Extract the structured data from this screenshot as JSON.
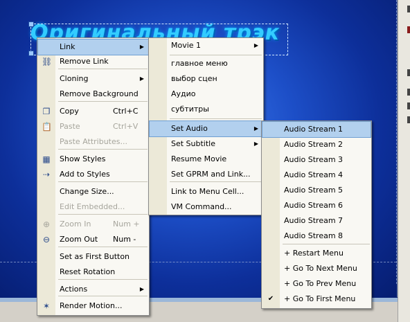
{
  "canvas_title": "Оригинальный трэк",
  "menu_main": {
    "items": [
      {
        "label": "Link",
        "shortcut": "",
        "has_submenu": true,
        "disabled": false,
        "icon": ""
      },
      {
        "label": "Remove Link",
        "shortcut": "",
        "has_submenu": false,
        "disabled": false,
        "icon": "unlink-icon"
      },
      {
        "label": "Cloning",
        "shortcut": "",
        "has_submenu": true,
        "disabled": false,
        "icon": ""
      },
      {
        "label": "Remove Background",
        "shortcut": "",
        "has_submenu": false,
        "disabled": false,
        "icon": ""
      },
      {
        "label": "Copy",
        "shortcut": "Ctrl+C",
        "has_submenu": false,
        "disabled": false,
        "icon": "copy-icon"
      },
      {
        "label": "Paste",
        "shortcut": "Ctrl+V",
        "has_submenu": false,
        "disabled": true,
        "icon": "paste-icon"
      },
      {
        "label": "Paste Attributes...",
        "shortcut": "",
        "has_submenu": false,
        "disabled": true,
        "icon": ""
      },
      {
        "label": "Show Styles",
        "shortcut": "",
        "has_submenu": false,
        "disabled": false,
        "icon": "styles-icon"
      },
      {
        "label": "Add to Styles",
        "shortcut": "",
        "has_submenu": false,
        "disabled": false,
        "icon": "add-styles-icon"
      },
      {
        "label": "Change Size...",
        "shortcut": "",
        "has_submenu": false,
        "disabled": false,
        "icon": ""
      },
      {
        "label": "Edit Embedded...",
        "shortcut": "",
        "has_submenu": false,
        "disabled": true,
        "icon": ""
      },
      {
        "label": "Zoom In",
        "shortcut": "Num +",
        "has_submenu": false,
        "disabled": true,
        "icon": "zoom-in-icon"
      },
      {
        "label": "Zoom Out",
        "shortcut": "Num -",
        "has_submenu": false,
        "disabled": false,
        "icon": "zoom-out-icon"
      },
      {
        "label": "Set as First Button",
        "shortcut": "",
        "has_submenu": false,
        "disabled": false,
        "icon": ""
      },
      {
        "label": "Reset Rotation",
        "shortcut": "",
        "has_submenu": false,
        "disabled": false,
        "icon": ""
      },
      {
        "label": "Actions",
        "shortcut": "",
        "has_submenu": true,
        "disabled": false,
        "icon": ""
      },
      {
        "label": "Render Motion...",
        "shortcut": "",
        "has_submenu": false,
        "disabled": false,
        "icon": "render-motion-icon"
      }
    ]
  },
  "menu_link": {
    "items": [
      {
        "label": "Movie 1",
        "has_submenu": true
      },
      {
        "label": "главное меню",
        "has_submenu": false
      },
      {
        "label": "выбор сцен",
        "has_submenu": false
      },
      {
        "label": "Аудио",
        "has_submenu": false
      },
      {
        "label": "субтитры",
        "has_submenu": false
      },
      {
        "label": "Set Audio",
        "has_submenu": true
      },
      {
        "label": "Set Subtitle",
        "has_submenu": true
      },
      {
        "label": "Resume Movie",
        "has_submenu": false
      },
      {
        "label": "Set GPRM and Link...",
        "has_submenu": false
      },
      {
        "label": "Link to Menu Cell...",
        "has_submenu": false
      },
      {
        "label": "VM Command...",
        "has_submenu": false
      }
    ]
  },
  "menu_audio": {
    "items": [
      {
        "label": "Audio Stream 1",
        "checked": false
      },
      {
        "label": "Audio Stream 2",
        "checked": false
      },
      {
        "label": "Audio Stream 3",
        "checked": false
      },
      {
        "label": "Audio Stream 4",
        "checked": false
      },
      {
        "label": "Audio Stream 5",
        "checked": false
      },
      {
        "label": "Audio Stream 6",
        "checked": false
      },
      {
        "label": "Audio Stream 7",
        "checked": false
      },
      {
        "label": "Audio Stream 8",
        "checked": false
      },
      {
        "label": "+ Restart Menu",
        "checked": false
      },
      {
        "label": "+ Go To Next Menu",
        "checked": false
      },
      {
        "label": "+ Go To Prev Menu",
        "checked": false
      },
      {
        "label": "+ Go To First Menu",
        "checked": true
      }
    ]
  },
  "colors": {
    "highlight": "#b2d0ee",
    "menu_bg": "#f9f8f3",
    "gutter": "#ece9d8",
    "disabled_text": "#a6a59c"
  }
}
